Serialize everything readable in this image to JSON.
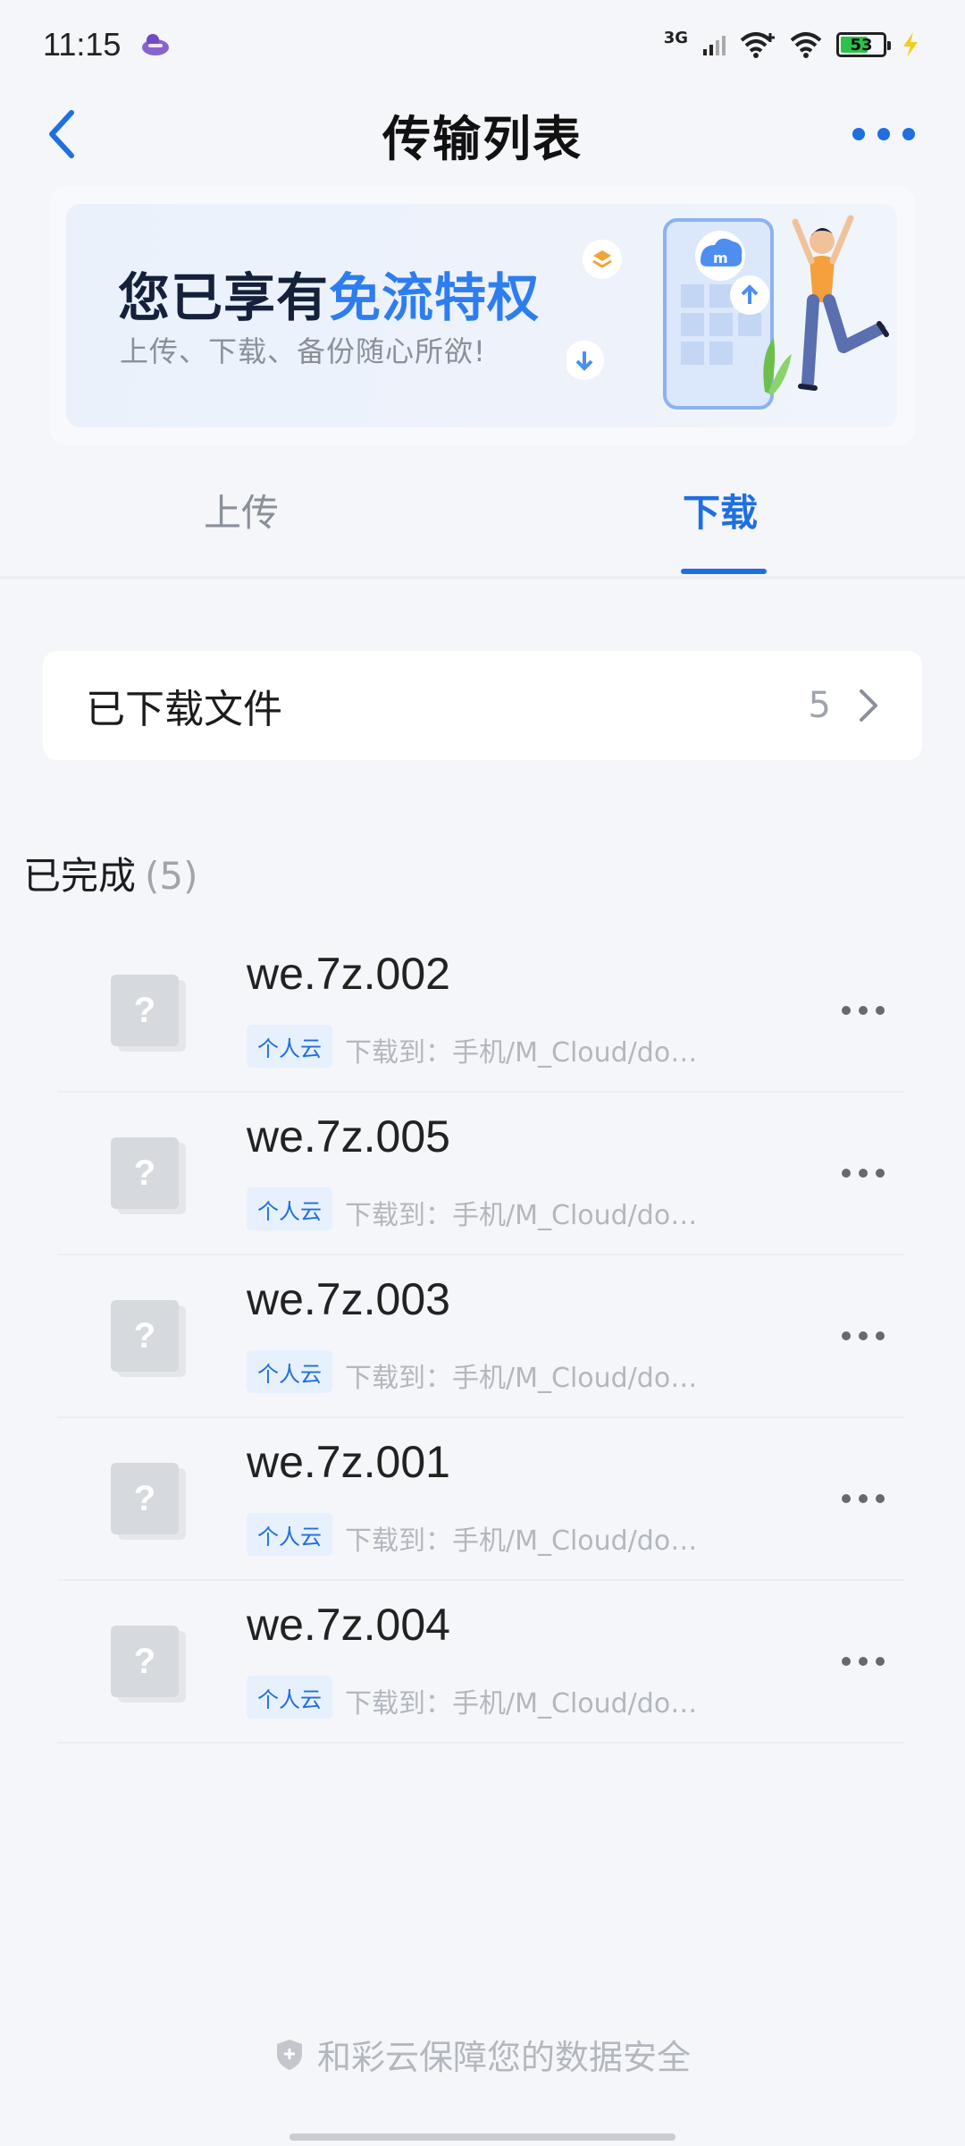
{
  "status_bar": {
    "time": "11:15",
    "network_type": "3G",
    "battery_level": "53",
    "icons": [
      "app-notification-icon",
      "signal-icon",
      "wifi-plus-icon",
      "wifi-icon",
      "battery-icon",
      "charging-icon"
    ]
  },
  "header": {
    "title": "传输列表",
    "back_icon": "back-arrow-icon",
    "more_icon": "more-icon"
  },
  "banner": {
    "title_prefix": "您已享有",
    "title_highlight": "免流特权",
    "subtitle": "上传、下载、备份随心所欲!",
    "accent_color": "#2e7df0"
  },
  "tabs": [
    {
      "label": "上传",
      "active": false
    },
    {
      "label": "下载",
      "active": true
    }
  ],
  "downloaded_files": {
    "label": "已下载文件",
    "count": "5"
  },
  "section": {
    "title": "已完成",
    "count": "(5)"
  },
  "files": [
    {
      "name": "we.7z.002",
      "tag": "个人云",
      "path": "下载到：手机/M_Cloud/do…"
    },
    {
      "name": "we.7z.005",
      "tag": "个人云",
      "path": "下载到：手机/M_Cloud/do…"
    },
    {
      "name": "we.7z.003",
      "tag": "个人云",
      "path": "下载到：手机/M_Cloud/do…"
    },
    {
      "name": "we.7z.001",
      "tag": "个人云",
      "path": "下载到：手机/M_Cloud/do…"
    },
    {
      "name": "we.7z.004",
      "tag": "个人云",
      "path": "下载到：手机/M_Cloud/do…"
    }
  ],
  "file_icon_glyph": "?",
  "footer": {
    "text": "和彩云保障您的数据安全"
  },
  "colors": {
    "primary": "#1f6fe0",
    "background": "#f4f6fa",
    "tag_background": "#e7f0fd"
  }
}
